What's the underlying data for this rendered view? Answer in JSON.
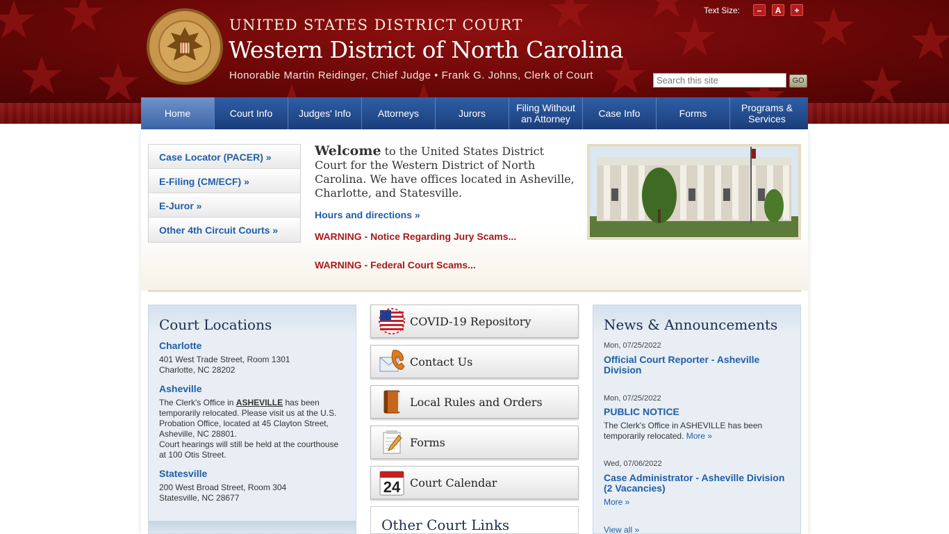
{
  "header": {
    "line1": "UNITED STATES DISTRICT COURT",
    "line2": "Western District of North Carolina",
    "line3": "Honorable Martin Reidinger, Chief Judge • Frank G. Johns, Clerk of Court",
    "seal_text": "UNITED STATES DISTRICT COURT • WESTERN DISTRICT OF NORTH CAROLINA",
    "text_size_label": "Text Size:",
    "text_size_minus": "–",
    "text_size_normal": "A",
    "text_size_plus": "+",
    "search_placeholder": "Search this site",
    "search_button": "GO"
  },
  "nav": {
    "home": "Home",
    "court_info": "Court Info",
    "judges_info": "Judges' Info",
    "attorneys": "Attorneys",
    "jurors": "Jurors",
    "filing_line1": "Filing Without",
    "filing_line2": "an Attorney",
    "case_info": "Case Info",
    "forms": "Forms",
    "programs_line1": "Programs &",
    "programs_line2": "Services"
  },
  "quick_links": [
    "Case Locator (PACER) »",
    "E-Filing (CM/ECF) »",
    "E-Juror »",
    "Other 4th Circuit Courts »"
  ],
  "welcome": {
    "strong": "Welcome",
    "text": " to the United States District Court for the Western District of North Carolina. We have offices located in Asheville, Charlotte, and Statesville.",
    "hours_link": "Hours and directions »",
    "warning1": "WARNING - Notice Regarding Jury Scams...",
    "warning2": "WARNING - Federal Court Scams..."
  },
  "locations": {
    "title": "Court Locations",
    "charlotte": {
      "name": "Charlotte",
      "line1": "401 West Trade Street, Room 1301",
      "line2": "Charlotte, NC  28202"
    },
    "asheville": {
      "name": "Asheville",
      "pre": "The Clerk's Office in ",
      "city": "ASHEVILLE",
      "post": " has been temporarily relocated. Please visit us at the U.S. Probation Office, located at 45 Clayton Street,",
      "line_addr": " Asheville, NC  28801.",
      "line_hearing": "Court hearings will still be held at the courthouse at 100 Otis Street."
    },
    "statesville": {
      "name": "Statesville",
      "line1": "200 West Broad Street, Room 304",
      "line2": "Statesville, NC  28677"
    }
  },
  "buttons": {
    "covid": "COVID-19 Repository",
    "contact": "Contact Us",
    "rules": "Local Rules and Orders",
    "forms": "Forms",
    "calendar": "Court Calendar",
    "calendar_day": "24"
  },
  "other_links_title": "Other Court Links",
  "news": {
    "title": "News & Announcements",
    "items": [
      {
        "date": "Mon, 07/25/2022",
        "title": "Official Court Reporter - Asheville Division"
      },
      {
        "date": "Mon, 07/25/2022",
        "title": "PUBLIC NOTICE",
        "body": "The Clerk's Office in ASHEVILLE has been temporarily relocated.",
        "more": "More »"
      },
      {
        "date": "Wed, 07/06/2022",
        "title": "Case Administrator - Asheville Division (2 Vacancies)",
        "more": "More »"
      }
    ],
    "view_all": "View all »"
  }
}
